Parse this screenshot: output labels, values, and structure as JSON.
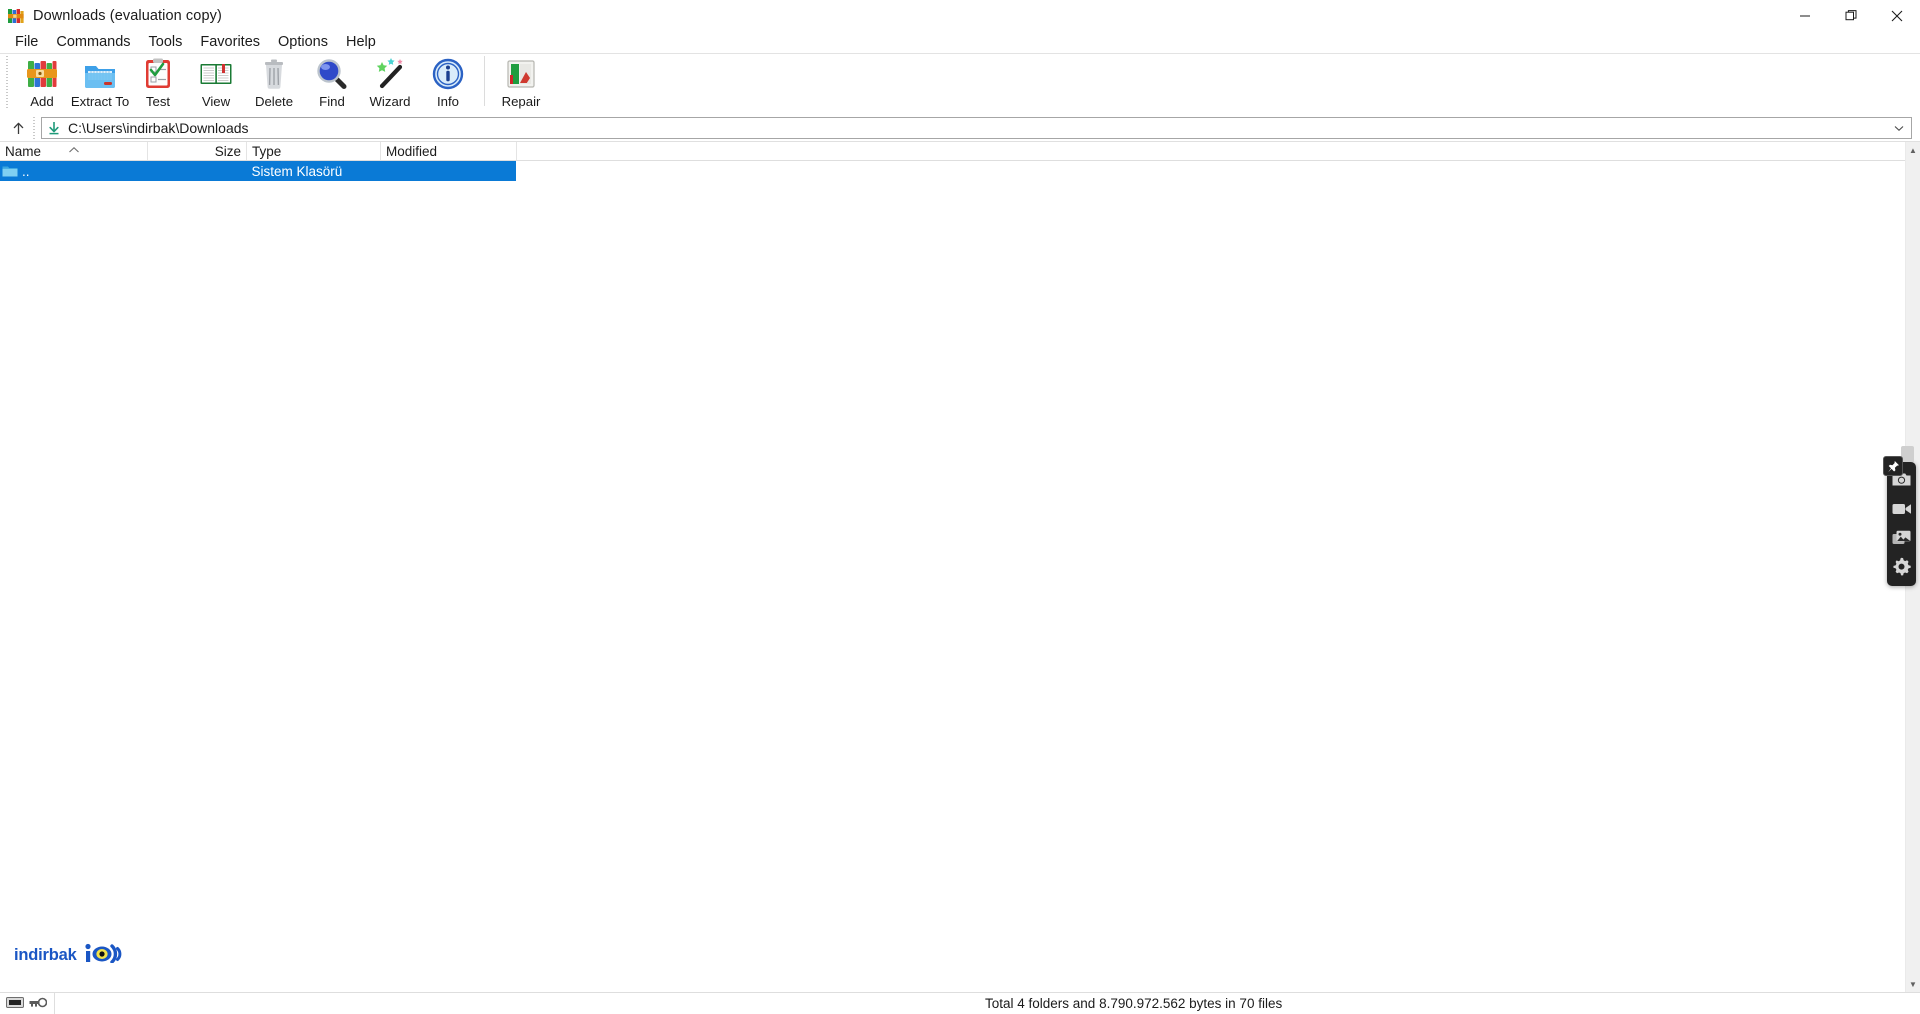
{
  "window": {
    "title": "Downloads (evaluation copy)",
    "app_icon": "winrar-books-icon",
    "controls": [
      {
        "name": "minimize-button",
        "glyph": "minimize-icon"
      },
      {
        "name": "maximize-button",
        "glyph": "restore-icon"
      },
      {
        "name": "close-button",
        "glyph": "close-icon"
      }
    ]
  },
  "menubar": {
    "items": [
      {
        "label": "File"
      },
      {
        "label": "Commands"
      },
      {
        "label": "Tools"
      },
      {
        "label": "Favorites"
      },
      {
        "label": "Options"
      },
      {
        "label": "Help"
      }
    ]
  },
  "toolbar": {
    "buttons": [
      {
        "label": "Add",
        "icon": "add-archive-icon"
      },
      {
        "label": "Extract To",
        "icon": "extract-folder-icon"
      },
      {
        "label": "Test",
        "icon": "clipboard-check-icon"
      },
      {
        "label": "View",
        "icon": "open-book-icon"
      },
      {
        "label": "Delete",
        "icon": "trash-bin-icon"
      },
      {
        "label": "Find",
        "icon": "magnifier-icon"
      },
      {
        "label": "Wizard",
        "icon": "magic-wand-icon"
      },
      {
        "label": "Info",
        "icon": "info-circle-icon"
      }
    ],
    "buttons_after_separator": [
      {
        "label": "Repair",
        "icon": "repair-hammer-icon"
      }
    ]
  },
  "address": {
    "up_button_label": "up-one-level",
    "path_icon": "download-arrow-icon",
    "path": "C:\\Users\\indirbak\\Downloads",
    "dropdown_icon": "chevron-down-icon"
  },
  "filelist": {
    "columns": [
      {
        "label": "Name",
        "align": "left",
        "sorted": true,
        "sort_direction": "ascending"
      },
      {
        "label": "Size",
        "align": "right",
        "sorted": false
      },
      {
        "label": "Type",
        "align": "left",
        "sorted": false
      },
      {
        "label": "Modified",
        "align": "left",
        "sorted": false
      }
    ],
    "rows": [
      {
        "name": "..",
        "size": "",
        "type": "Sistem Klasörü",
        "modified": "",
        "icon": "parent-folder-icon",
        "selected": true
      },
      {
        "name": "",
        "size": "",
        "type": "",
        "modified": "",
        "icon": "folder-icon",
        "selected": false,
        "clipped": true
      }
    ]
  },
  "watermark": {
    "text": "indirbak",
    "logo_icon": "indirbak-eye-logo"
  },
  "statusbar": {
    "left_icons": [
      {
        "name": "archive-state-icon"
      },
      {
        "name": "key-icon"
      }
    ],
    "text": "Total 4 folders and 8.790.972.562 bytes in 70 files"
  },
  "recorder_widget": {
    "buttons": [
      {
        "name": "pin-widget-button",
        "icon": "pin-icon"
      },
      {
        "name": "screenshot-button",
        "icon": "camera-icon"
      },
      {
        "name": "record-video-button",
        "icon": "video-camera-icon"
      },
      {
        "name": "gallery-button",
        "icon": "image-stack-icon"
      },
      {
        "name": "settings-button",
        "icon": "gear-icon"
      }
    ]
  },
  "colors": {
    "selection": "#0a7ad6",
    "accent_brand": "#1a56c4",
    "window_bg": "#ffffff",
    "text": "#1b1b1b"
  }
}
